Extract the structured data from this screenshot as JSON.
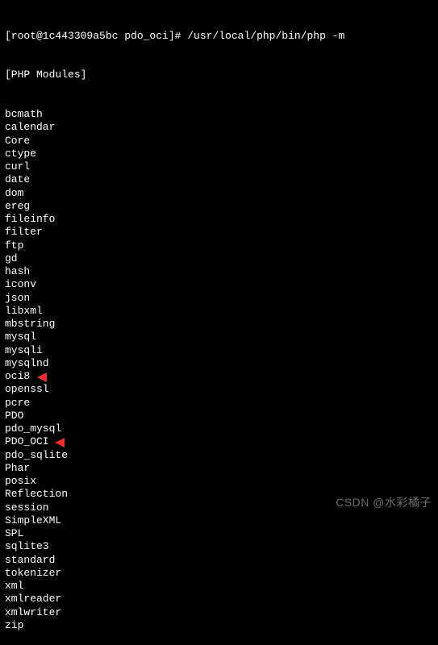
{
  "prompt": {
    "user_host": "[root@1c443309a5bc pdo_oci]# ",
    "command": "/usr/local/php/bin/php -m"
  },
  "header": "[PHP Modules]",
  "modules": [
    "bcmath",
    "calendar",
    "Core",
    "ctype",
    "curl",
    "date",
    "dom",
    "ereg",
    "fileinfo",
    "filter",
    "ftp",
    "gd",
    "hash",
    "iconv",
    "json",
    "libxml",
    "mbstring",
    "mysql",
    "mysqli",
    "mysqlnd",
    "oci8",
    "openssl",
    "pcre",
    "PDO",
    "pdo_mysql",
    "PDO_OCI",
    "pdo_sqlite",
    "Phar",
    "posix",
    "Reflection",
    "session",
    "SimpleXML",
    "SPL",
    "sqlite3",
    "standard",
    "tokenizer",
    "xml",
    "xmlreader",
    "xmlwriter",
    "zip"
  ],
  "highlighted_modules": [
    "oci8",
    "PDO_OCI"
  ],
  "watermark": "CSDN @水彩橘子"
}
